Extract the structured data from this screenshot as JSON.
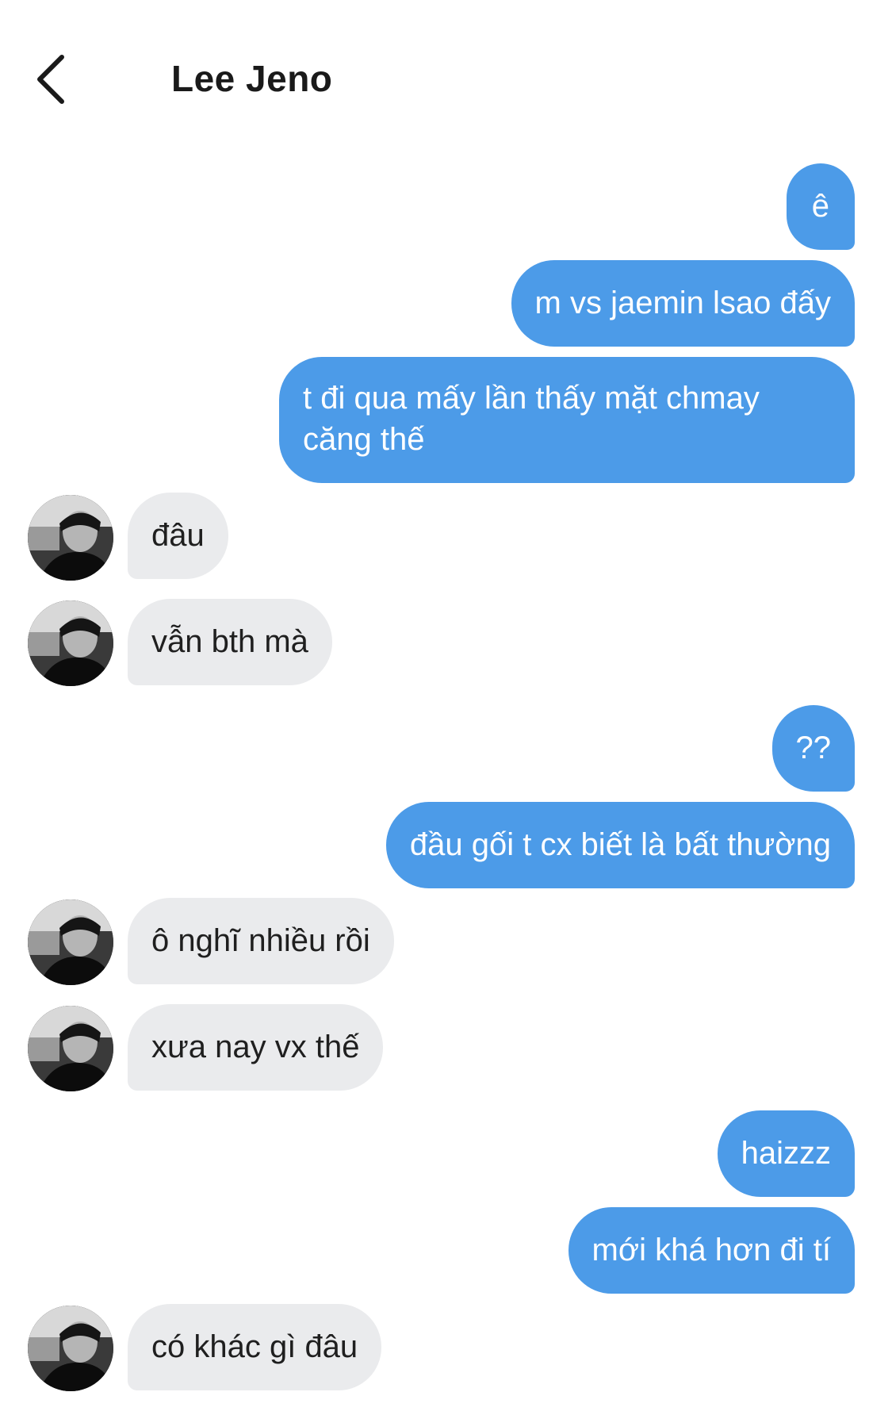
{
  "header": {
    "title": "Lee Jeno",
    "back_icon": "chevron-left-icon"
  },
  "colors": {
    "sent_bubble": "#4c9be8",
    "received_bubble": "#eaebed",
    "background": "#ffffff"
  },
  "messages": [
    {
      "from": "me",
      "text": "ê"
    },
    {
      "from": "me",
      "text": "m vs jaemin lsao đấy"
    },
    {
      "from": "me",
      "text": "t đi qua mấy lần thấy mặt chmay căng thế"
    },
    {
      "from": "them",
      "text": "đâu"
    },
    {
      "from": "them",
      "text": "vẫn bth mà"
    },
    {
      "from": "me",
      "text": "??"
    },
    {
      "from": "me",
      "text": "đầu gối t cx biết là bất thường"
    },
    {
      "from": "them",
      "text": "ô nghĩ nhiều rồi"
    },
    {
      "from": "them",
      "text": "xưa nay vx thế"
    },
    {
      "from": "me",
      "text": "haizzz"
    },
    {
      "from": "me",
      "text": "mới khá hơn đi tí"
    },
    {
      "from": "them",
      "text": "có khác gì đâu"
    }
  ]
}
